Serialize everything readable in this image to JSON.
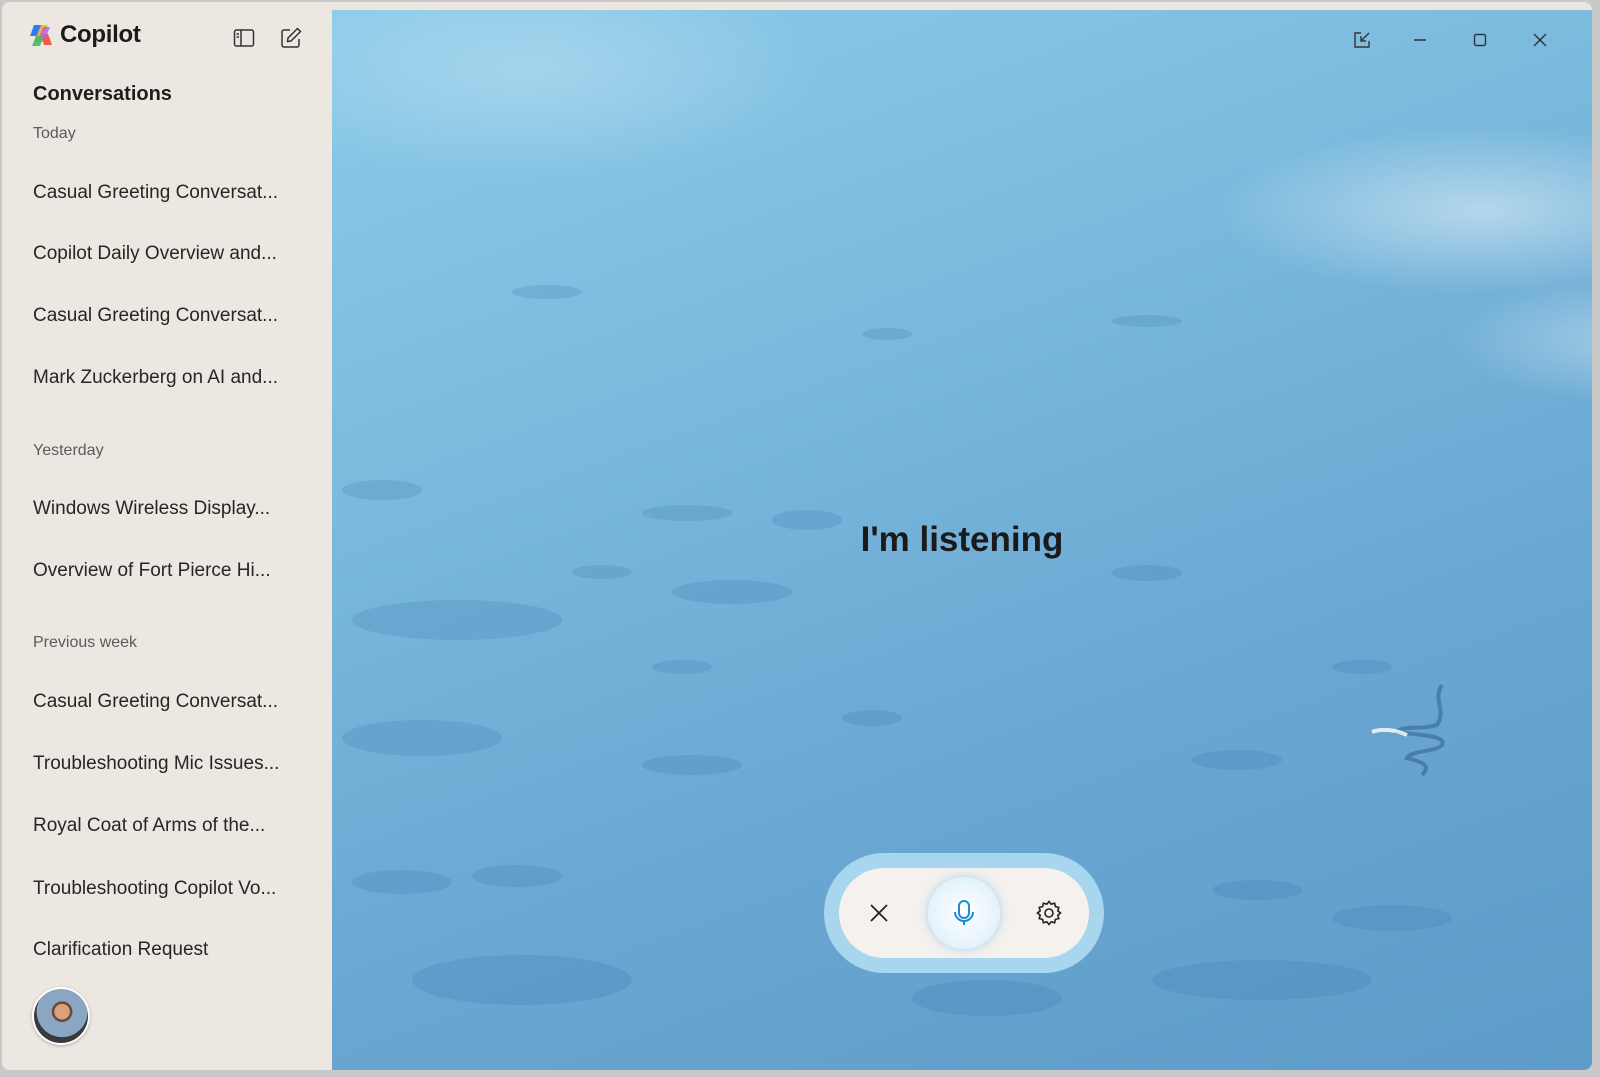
{
  "app": {
    "name": "Copilot"
  },
  "sidebar": {
    "title": "Conversations",
    "groups": [
      {
        "label": "Today",
        "items": [
          "Casual Greeting Conversat...",
          "Copilot Daily Overview and...",
          "Casual Greeting Conversat...",
          "Mark Zuckerberg on AI and..."
        ]
      },
      {
        "label": "Yesterday",
        "items": [
          "Windows Wireless Display...",
          "Overview of Fort Pierce Hi..."
        ]
      },
      {
        "label": "Previous week",
        "items": [
          "Casual Greeting Conversat...",
          "Troubleshooting Mic Issues...",
          "Royal Coat of Arms of the...",
          "Troubleshooting Copilot Vo...",
          "Clarification Request"
        ]
      }
    ],
    "icons": {
      "toggle": "sidebar-toggle-icon",
      "new_chat": "new-chat-icon"
    }
  },
  "main": {
    "status": "I'm listening",
    "window_controls": [
      "pop-out-icon",
      "minimize-icon",
      "maximize-icon",
      "close-icon"
    ],
    "voice_controls": [
      "close-icon",
      "microphone-icon",
      "gear-icon"
    ]
  },
  "colors": {
    "sidebar_bg": "#ede7e2",
    "accent": "#1f8ad2",
    "voice_bar": "#afdcf2"
  }
}
